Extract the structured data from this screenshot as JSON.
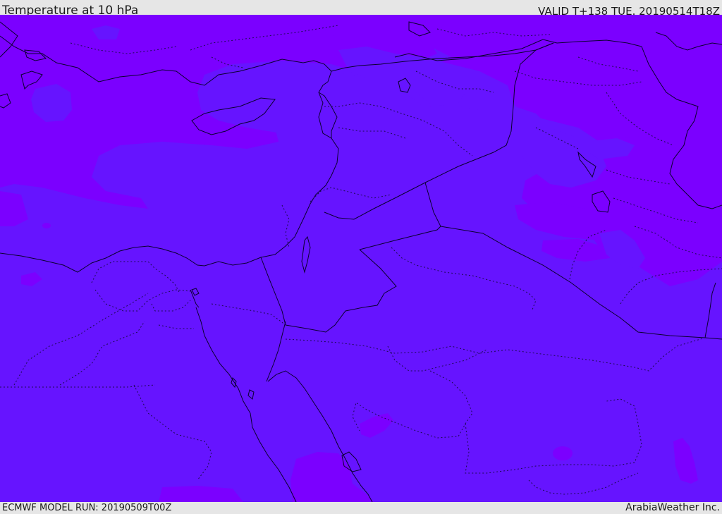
{
  "header": {
    "title": "Temperature at 10 hPa",
    "valid": "VALID T+138 TUE. 20190514T18Z"
  },
  "footer": {
    "model_run": "ECMWF MODEL RUN: 20190509T00Z",
    "credit": "ArabiaWeather Inc."
  },
  "colors": {
    "background_bar": "#e6e6e6",
    "field_warm": "#7b00ff",
    "field_cool": "#6614ff",
    "coastline": "#0a0030"
  }
}
